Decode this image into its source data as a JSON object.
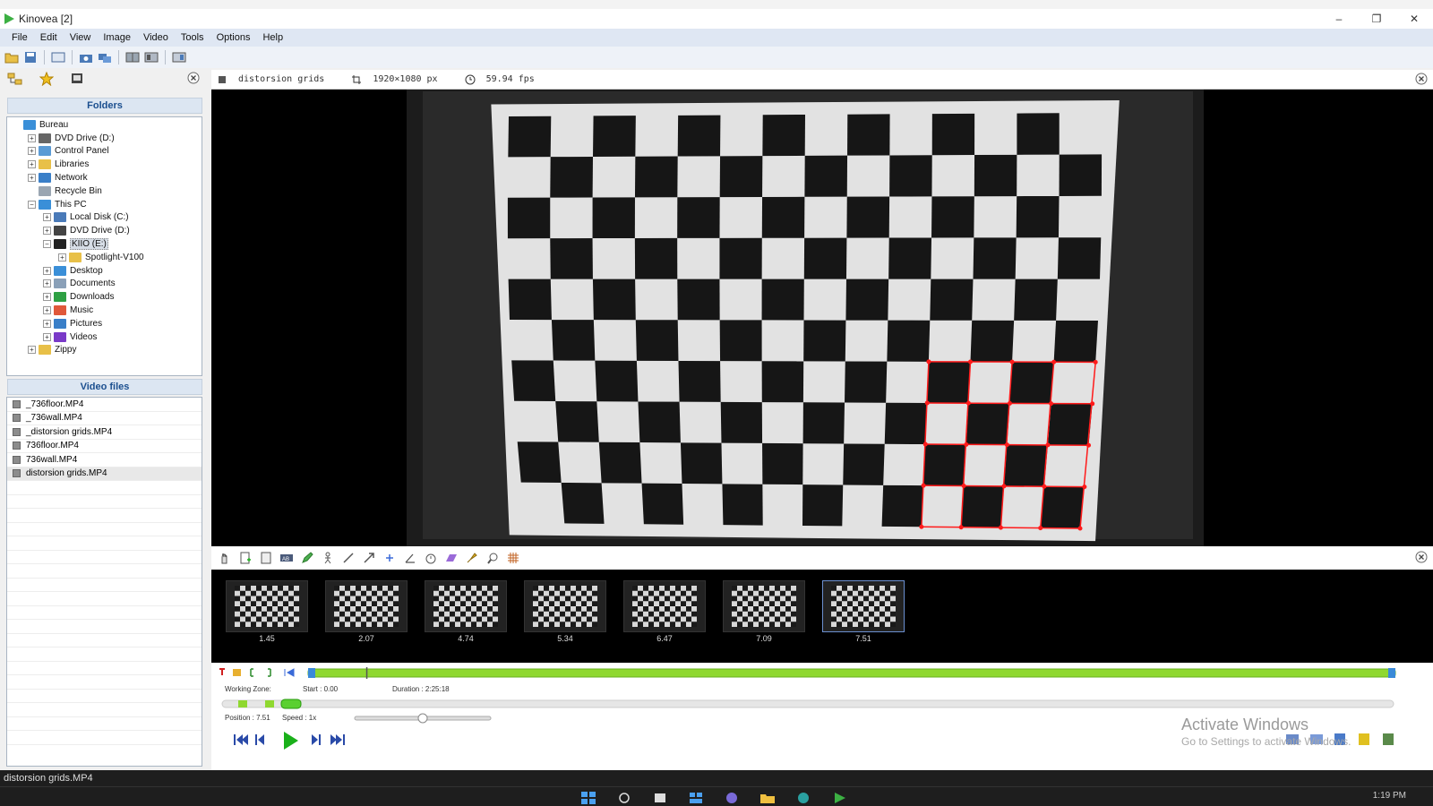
{
  "window": {
    "title": "Kinovea [2]",
    "minimize": "–",
    "maximize": "❐",
    "close": "✕"
  },
  "menu": [
    "File",
    "Edit",
    "View",
    "Image",
    "Video",
    "Tools",
    "Options",
    "Help"
  ],
  "left_panel": {
    "folders_header": "Folders",
    "tree": [
      {
        "label": "Bureau",
        "depth": 0,
        "exp": "",
        "icon": "desktop-icon",
        "color": "#3a8fd8"
      },
      {
        "label": "DVD Drive (D:)",
        "depth": 1,
        "exp": "+",
        "icon": "dvd-drive-icon",
        "color": "#666666"
      },
      {
        "label": "Control Panel",
        "depth": 1,
        "exp": "+",
        "icon": "control-panel-icon",
        "color": "#5b9bd5"
      },
      {
        "label": "Libraries",
        "depth": 1,
        "exp": "+",
        "icon": "folder-icon",
        "color": "#e8c048"
      },
      {
        "label": "Network",
        "depth": 1,
        "exp": "+",
        "icon": "network-icon",
        "color": "#3a7fc8"
      },
      {
        "label": "Recycle Bin",
        "depth": 1,
        "exp": "",
        "icon": "recycle-bin-icon",
        "color": "#9aa6b2"
      },
      {
        "label": "This PC",
        "depth": 1,
        "exp": "−",
        "icon": "computer-icon",
        "color": "#3a8fd8"
      },
      {
        "label": "Local Disk (C:)",
        "depth": 2,
        "exp": "+",
        "icon": "hard-disk-icon",
        "color": "#4a7ab8"
      },
      {
        "label": "DVD Drive (D:)",
        "depth": 2,
        "exp": "+",
        "icon": "dvd-drive-icon",
        "color": "#444444"
      },
      {
        "label": "KIIO (E:)",
        "depth": 2,
        "exp": "−",
        "icon": "usb-drive-icon",
        "color": "#222222",
        "selected": true
      },
      {
        "label": "Spotlight-V100",
        "depth": 3,
        "exp": "+",
        "icon": "folder-icon",
        "color": "#e8c048"
      },
      {
        "label": "Desktop",
        "depth": 2,
        "exp": "+",
        "icon": "desktop-folder-icon",
        "color": "#3a8fd8"
      },
      {
        "label": "Documents",
        "depth": 2,
        "exp": "+",
        "icon": "documents-icon",
        "color": "#8aa0b8"
      },
      {
        "label": "Downloads",
        "depth": 2,
        "exp": "+",
        "icon": "downloads-icon",
        "color": "#2ea043"
      },
      {
        "label": "Music",
        "depth": 2,
        "exp": "+",
        "icon": "music-icon",
        "color": "#e0583a"
      },
      {
        "label": "Pictures",
        "depth": 2,
        "exp": "+",
        "icon": "pictures-icon",
        "color": "#3a7fc8"
      },
      {
        "label": "Videos",
        "depth": 2,
        "exp": "+",
        "icon": "videos-icon",
        "color": "#7a3ac8"
      },
      {
        "label": "Zippy",
        "depth": 1,
        "exp": "+",
        "icon": "folder-icon",
        "color": "#e8c048"
      }
    ],
    "video_files_header": "Video files",
    "files": [
      {
        "name": "_736floor.MP4"
      },
      {
        "name": "_736wall.MP4"
      },
      {
        "name": "_distorsion grids.MP4"
      },
      {
        "name": "736floor.MP4"
      },
      {
        "name": "736wall.MP4"
      },
      {
        "name": "distorsion grids.MP4",
        "selected": true
      }
    ]
  },
  "player": {
    "filename": "distorsion grids",
    "resolution": "1920×1080 px",
    "framerate": "59.94 fps",
    "thumbnails": [
      "1.45",
      "2.07",
      "4.74",
      "5.34",
      "6.47",
      "7.09",
      "7.51"
    ],
    "active_thumbnail": 6,
    "working_zone_label": "Working Zone:",
    "start": "Start : 0.00",
    "duration": "Duration : 2:25:18",
    "position": "Position : 7.51",
    "speed": "Speed : 1x",
    "speed_slider_fraction": 0.5,
    "playhead_fraction": 0.054
  },
  "watermark": {
    "line1": "Activate Windows",
    "line2": "Go to Settings to activate Windows."
  },
  "status": "distorsion grids.MP4",
  "clock": "1:19 PM"
}
